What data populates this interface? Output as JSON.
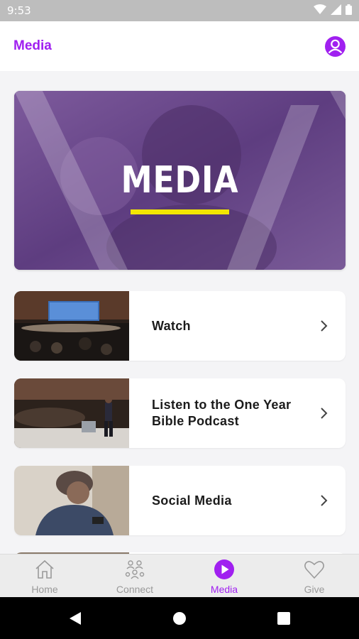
{
  "status_bar": {
    "time": "9:53"
  },
  "app_bar": {
    "title": "Media"
  },
  "hero": {
    "title": "MEDIA"
  },
  "items": [
    {
      "label": "Watch"
    },
    {
      "label": "Listen to the One Year Bible Podcast"
    },
    {
      "label": "Social Media"
    }
  ],
  "bottom_nav": [
    {
      "label": "Home",
      "icon": "home-icon",
      "active": false
    },
    {
      "label": "Connect",
      "icon": "connect-icon",
      "active": false
    },
    {
      "label": "Media",
      "icon": "play-icon",
      "active": true
    },
    {
      "label": "Give",
      "icon": "heart-icon",
      "active": false
    }
  ],
  "colors": {
    "accent": "#a020f0",
    "hero_overlay": "#6b4a8c",
    "underline": "#f3e600"
  }
}
